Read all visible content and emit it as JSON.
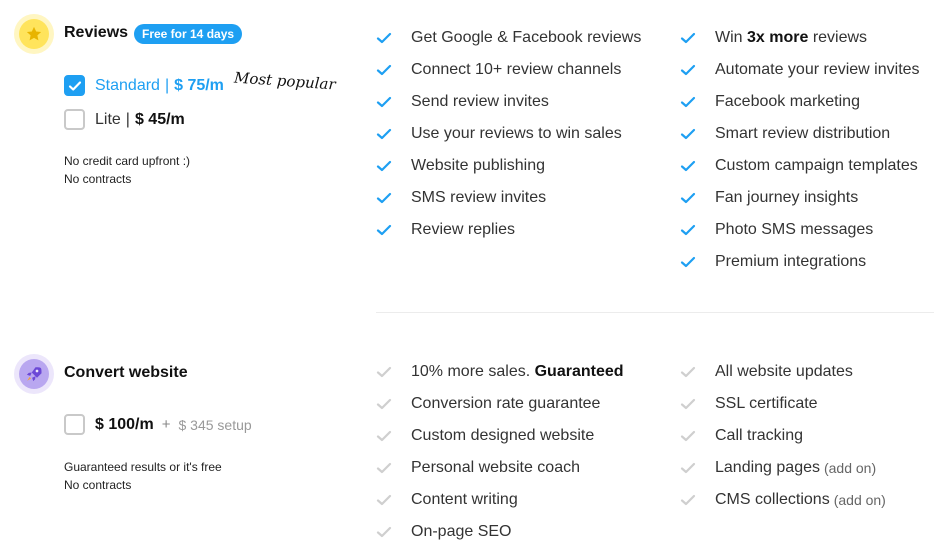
{
  "reviews": {
    "title": "Reviews",
    "badge": "Free for 14 days",
    "icon": "star-icon",
    "plans": {
      "standard": {
        "name": "Standard",
        "sep": "|",
        "price": "$ 75/m",
        "checked": true
      },
      "lite": {
        "name": "Lite",
        "sep": "|",
        "price": "$ 45/m",
        "checked": false
      }
    },
    "most_popular": "Most popular",
    "notes": [
      "No credit card upfront :)",
      "No contracts"
    ],
    "features_left": [
      "Get Google & Facebook reviews",
      "Connect 10+ review channels",
      "Send review invites",
      "Use your reviews to win sales",
      "Website publishing",
      "SMS review invites",
      "Review replies"
    ],
    "features_right": [
      {
        "pre": "Win ",
        "bold": "3x more",
        "post": " reviews"
      },
      {
        "pre": "Automate your review invites"
      },
      {
        "pre": "Facebook marketing"
      },
      {
        "pre": "Smart review distribution"
      },
      {
        "pre": "Custom campaign templates"
      },
      {
        "pre": "Fan journey insights"
      },
      {
        "pre": "Photo SMS messages"
      },
      {
        "pre": "Premium integrations"
      }
    ]
  },
  "convert": {
    "title": "Convert website",
    "icon": "rocket-icon",
    "plan": {
      "price": "$ 100/m",
      "plus": "+",
      "setup": "$ 345 setup",
      "checked": false
    },
    "notes": [
      "Guaranteed results or it's free",
      "No contracts"
    ],
    "features_left": [
      {
        "pre": "10% more sales. ",
        "bold": "Guaranteed"
      },
      {
        "pre": "Conversion rate guarantee"
      },
      {
        "pre": "Custom designed website"
      },
      {
        "pre": "Personal website coach"
      },
      {
        "pre": "Content writing"
      },
      {
        "pre": "On-page SEO"
      }
    ],
    "features_right": [
      {
        "pre": "All website updates"
      },
      {
        "pre": "SSL certificate"
      },
      {
        "pre": "Call tracking"
      },
      {
        "pre": "Landing pages",
        "addon": "(add on)"
      },
      {
        "pre": "CMS collections",
        "addon": "(add on)"
      }
    ]
  },
  "colors": {
    "accent": "#1e9ff2",
    "check_active": "#1e9ff2",
    "check_muted": "#cfcfcf"
  }
}
